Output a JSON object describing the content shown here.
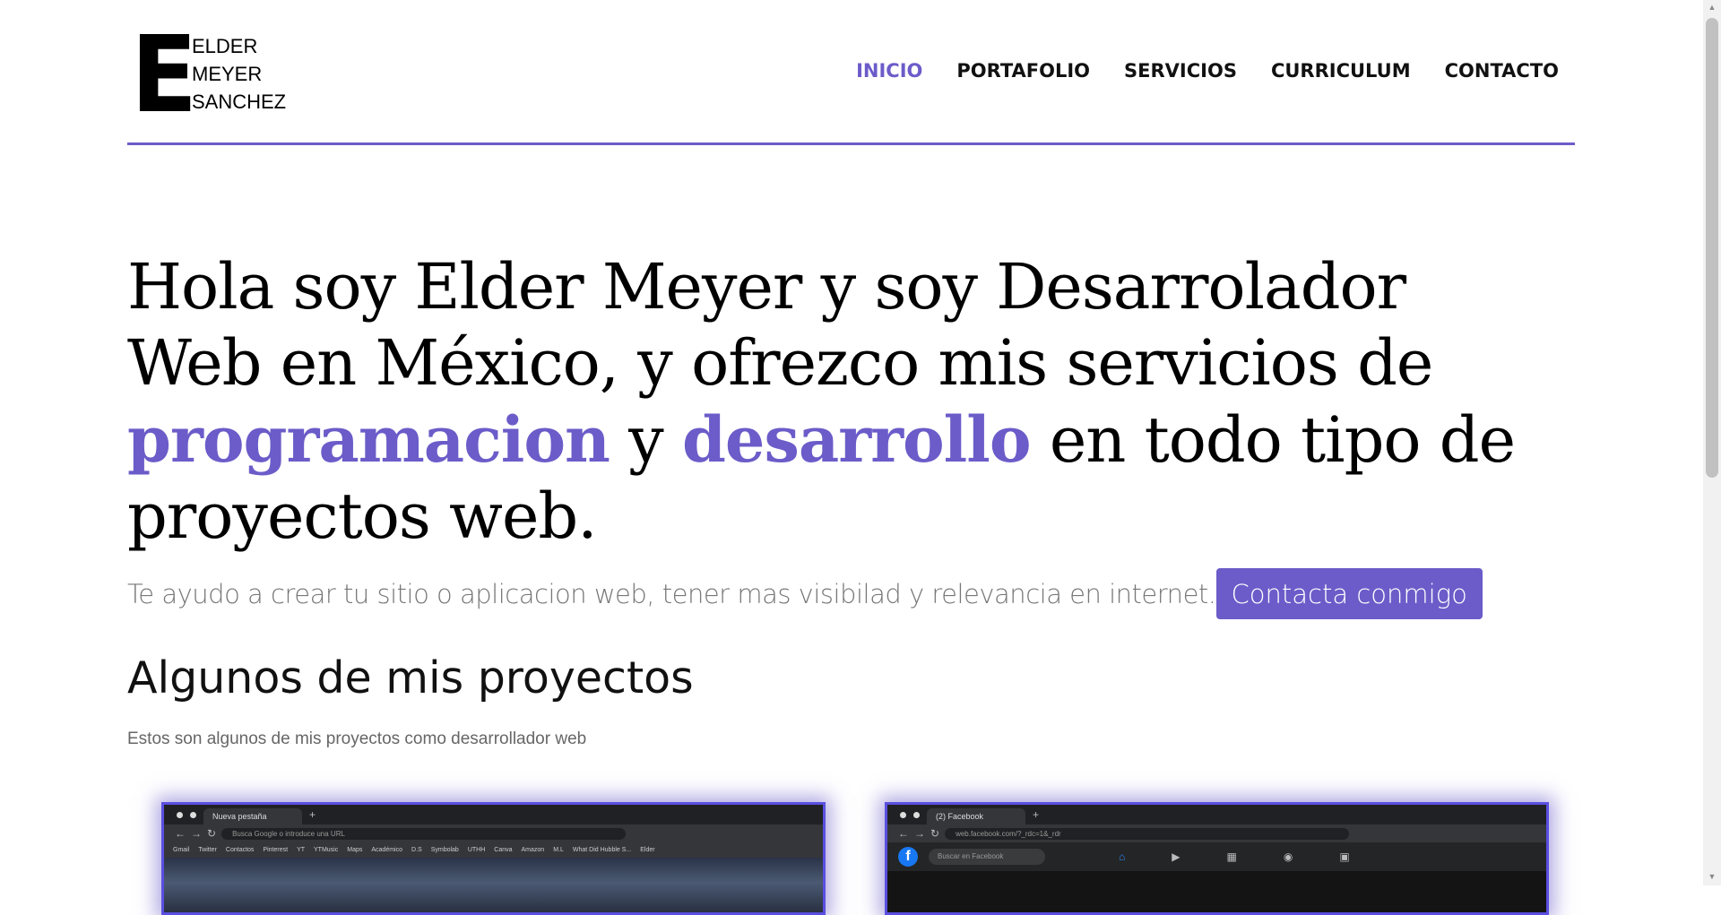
{
  "logo": {
    "letter": "E",
    "line1": "ELDER",
    "line2": "MEYER",
    "line3": "SANCHEZ"
  },
  "nav": {
    "items": [
      "INICIO",
      "PORTAFOLIO",
      "SERVICIOS",
      "CURRICULUM",
      "CONTACTO"
    ],
    "active": "INICIO"
  },
  "hero": {
    "part1": "Hola soy Elder Meyer y soy Desarrolador Web en México, y ofrezco mis servicios de ",
    "highlight1": "programacion",
    "part2": " y ",
    "highlight2": "desarrollo",
    "part3": " en todo tipo de proyectos web."
  },
  "subtitle": "Te ayudo a crear tu sitio o aplicacion web, tener mas visibilad y relevancia en internet.",
  "cta_label": "Contacta conmigo",
  "section": {
    "title": "Algunos de mis proyectos",
    "description": "Estos son algunos de mis proyectos como desarrollador web"
  },
  "projects": [
    {
      "tab": "Nueva pestaña",
      "address": "Busca Google o introduce una URL",
      "bookmarks": [
        "Gmail",
        "Twitter",
        "Contactos",
        "Pinterest",
        "YT",
        "YTMusic",
        "Maps",
        "Académico",
        "D.S",
        "Symbolab",
        "UTHH",
        "Canva",
        "Amazon",
        "M.L",
        "What Did Hubble S...",
        "Elder"
      ]
    },
    {
      "tab": "(2) Facebook",
      "address": "web.facebook.com/?_rdc=1&_rdr",
      "search": "Buscar en Facebook"
    }
  ],
  "colors": {
    "accent": "#6b5cc9"
  }
}
